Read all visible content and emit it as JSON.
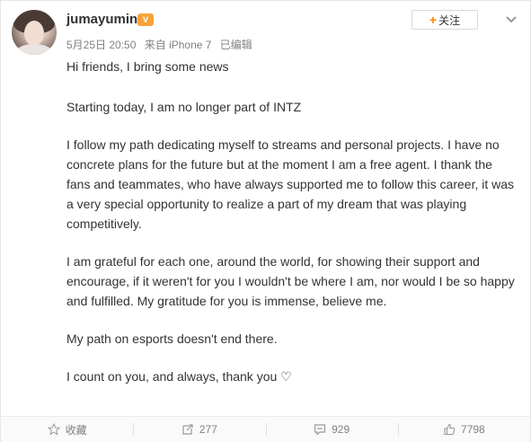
{
  "post": {
    "username": "jumayumin",
    "vip_badge": "V",
    "date": "5月25日 20:50",
    "source": "来自 iPhone 7",
    "edited": "已编辑",
    "follow_label": "关注",
    "follow_plus": "+",
    "paragraphs": [
      "Hi friends, I bring some news",
      "Starting today, I am no longer part of INTZ",
      "I follow my path dedicating myself to streams and personal projects.  I have no concrete plans for the future but at the moment I am a free agent. I thank the fans and teammates, who have always supported me to follow this career, it was a very special opportunity to realize a part of my dream that was playing competitively.",
      "I am grateful for each one, around the world, for showing their support and encourage, if it weren't for you I wouldn't be where I am, nor would I be so happy and fulfilled.  My gratitude for you is immense, believe me.",
      "My path on esports doesn't end there.",
      "I count on you, and always, thank you ♡"
    ]
  },
  "actions": {
    "favorite_label": "收藏",
    "repost_count": "277",
    "comment_count": "929",
    "like_count": "7798"
  },
  "icons": {
    "favorite": "star-icon",
    "repost": "repost-icon",
    "comment": "comment-icon",
    "like": "thumbs-up-icon",
    "menu": "chevron-down-icon"
  },
  "colors": {
    "accent": "#ff8200",
    "text": "#333333",
    "muted": "#808080"
  }
}
